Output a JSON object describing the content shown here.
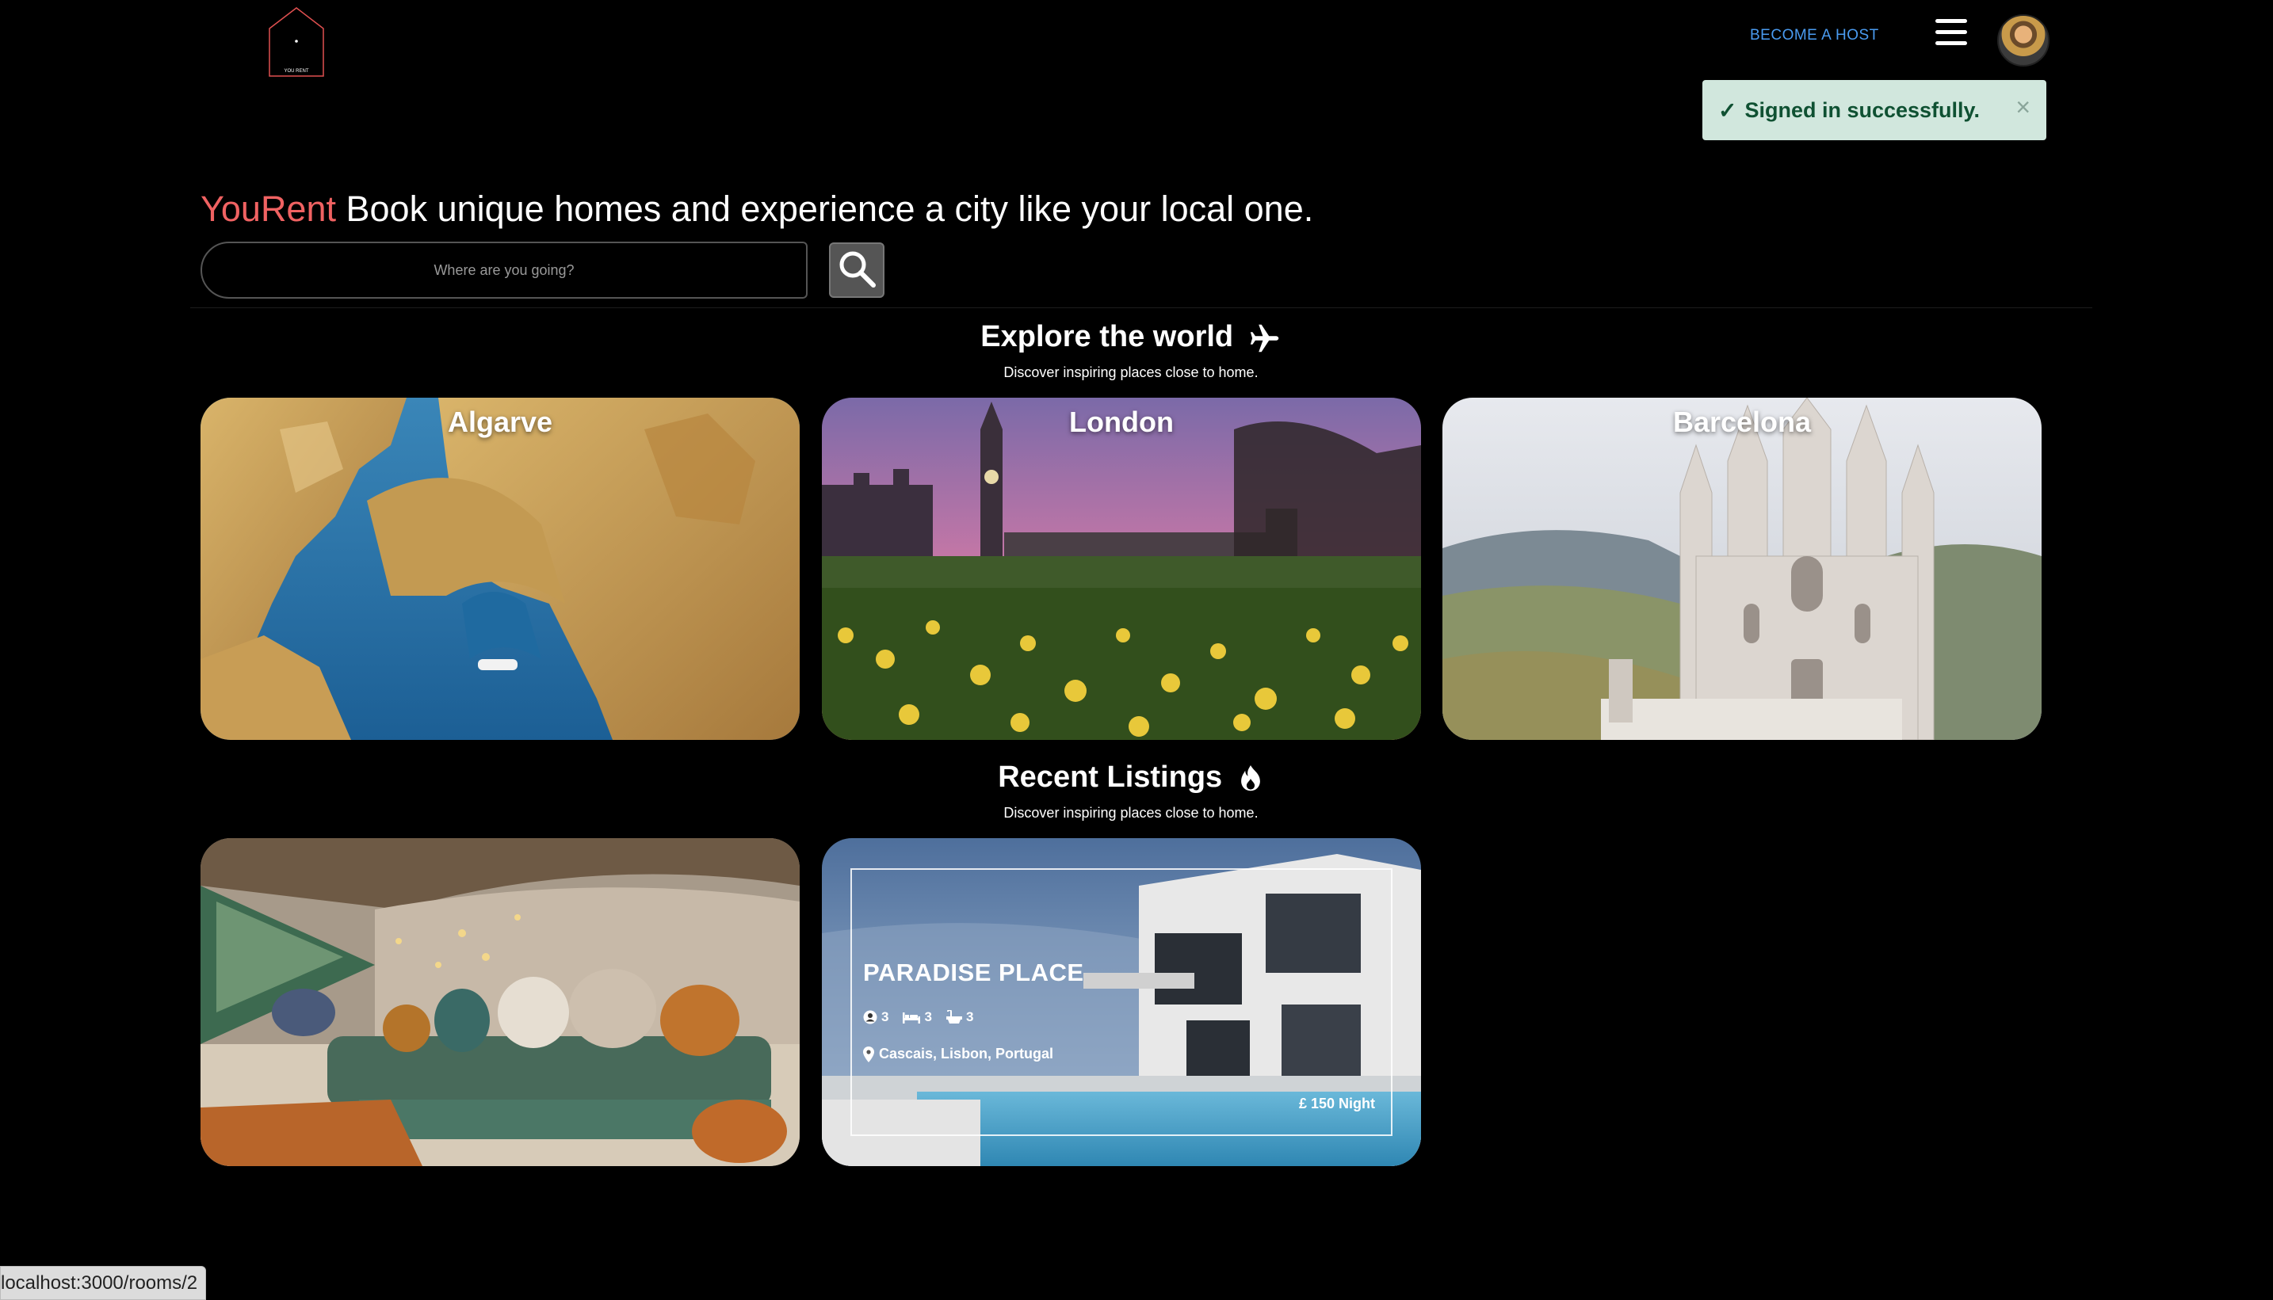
{
  "header": {
    "logo_text": "YOU RENT",
    "become_host_label": "BECOME A HOST",
    "menu_icon": "hamburger-icon",
    "avatar_icon": "user-avatar"
  },
  "toast": {
    "message": "Signed in successfully.",
    "check_icon": "check-icon",
    "close_label": "×"
  },
  "hero": {
    "brand": "YouRent",
    "tagline": " Book unique homes and experience a city like your local one.",
    "search_placeholder": "Where are you going?",
    "search_icon": "search-icon"
  },
  "explore": {
    "title": "Explore the world",
    "title_icon": "airplane-icon",
    "subtitle": "Discover inspiring places close to home.",
    "cities": [
      {
        "name": "Algarve"
      },
      {
        "name": "London"
      },
      {
        "name": "Barcelona"
      }
    ]
  },
  "recent": {
    "title": "Recent Listings",
    "title_icon": "fire-icon",
    "subtitle": "Discover inspiring places close to home.",
    "listings": [
      {
        "name": "",
        "image": "boho-living-room"
      },
      {
        "name": "PARADISE PLACE",
        "guests": "3",
        "beds": "3",
        "baths": "3",
        "location": "Cascais, Lisbon, Portugal",
        "price": "£ 150 Night"
      }
    ]
  },
  "status_url": "localhost:3000/rooms/2",
  "colors": {
    "brand": "#f06262",
    "link": "#4a9bf0",
    "toast_bg": "#d1e7dd",
    "toast_text": "#0f5132"
  }
}
